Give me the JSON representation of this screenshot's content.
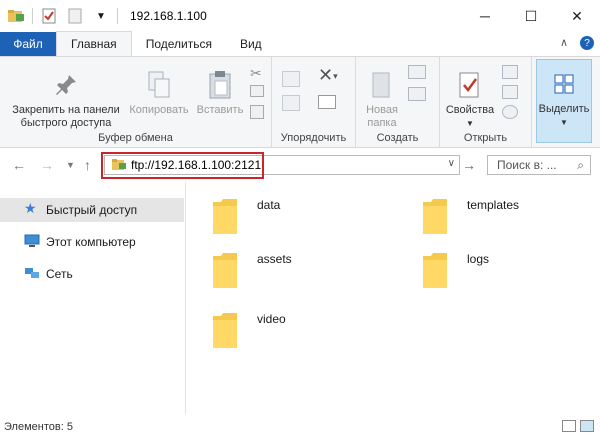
{
  "window": {
    "title": "192.168.1.100",
    "minimize": "─",
    "maximize": "☐",
    "close": "✕"
  },
  "tabs": {
    "file": "Файл",
    "items": [
      "Главная",
      "Поделиться",
      "Вид"
    ]
  },
  "ribbon": {
    "clipboard": {
      "label": "Буфер обмена",
      "pin": "Закрепить на панели быстрого доступа",
      "pin_line1": "Закрепить на панели",
      "pin_line2": "быстрого доступа",
      "copy": "Копировать",
      "paste": "Вставить"
    },
    "organize": {
      "label": "Упорядочить"
    },
    "create": {
      "label": "Создать",
      "new_folder_line1": "Новая",
      "new_folder_line2": "папка"
    },
    "open": {
      "label": "Открыть",
      "properties": "Свойства"
    },
    "select": {
      "label": "Выделить"
    }
  },
  "address": {
    "value": "ftp://192.168.1.100:2121",
    "search_placeholder": "Поиск в: ..."
  },
  "nav": {
    "items": [
      {
        "label": "Быстрый доступ",
        "icon": "star-icon"
      },
      {
        "label": "Этот компьютер",
        "icon": "computer-icon"
      },
      {
        "label": "Сеть",
        "icon": "network-icon"
      }
    ]
  },
  "folders": [
    "data",
    "templates",
    "assets",
    "logs",
    "video"
  ],
  "status": {
    "count": "Элементов: 5"
  }
}
